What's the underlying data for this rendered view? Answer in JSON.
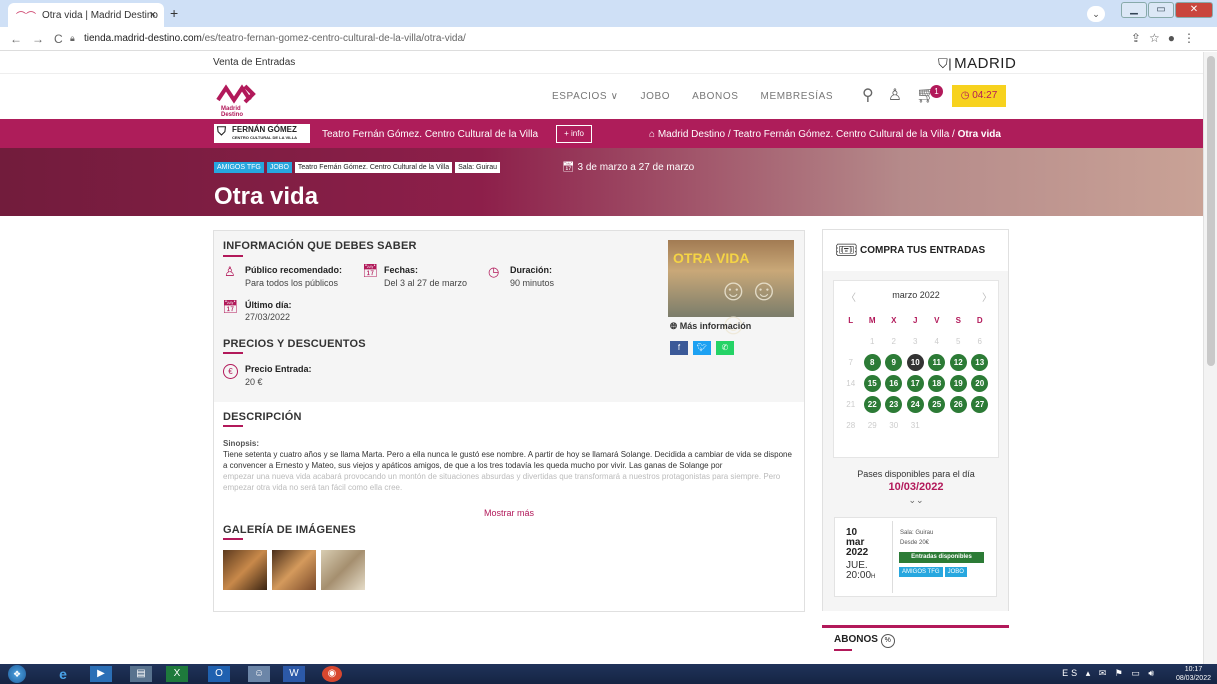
{
  "browser": {
    "tab_title": "Otra vida | Madrid Destino",
    "tab_close": "×",
    "new_tab": "+",
    "url_host": "tienda.madrid-destino.com",
    "url_path": "/es/teatro-fernan-gomez-centro-cultural-de-la-villa/otra-vida/"
  },
  "site": {
    "top_label": "Venta de Entradas",
    "madrid_label": "MADRID",
    "logo_text": "Madrid Destino",
    "nav": [
      "ESPACIOS ∨",
      "JOBO",
      "ABONOS",
      "MEMBRESÍAS"
    ],
    "cart_count": "1",
    "timer": "◷ 04:27"
  },
  "venue_bar": {
    "logo_title": "FERNÁN GÓMEZ",
    "logo_sub": "CENTRO CULTURAL DE LA VILLA",
    "venue_name": "Teatro Fernán Gómez. Centro Cultural de la Villa",
    "info_button": "+ info",
    "breadcrumb_prefix": "⌂ Madrid Destino / Teatro Fernán Gómez. Centro Cultural de la Villa / ",
    "breadcrumb_current": "Otra vida"
  },
  "hero": {
    "tags": [
      {
        "text": "AMIGOS TFG",
        "style": "blue"
      },
      {
        "text": "JOBO",
        "style": "blue"
      },
      {
        "text": "Teatro Fernán Gómez. Centro Cultural de la Villa",
        "style": "white"
      },
      {
        "text": "Sala: Guirau",
        "style": "white"
      }
    ],
    "dates": "3 de marzo a 27 de marzo",
    "title": "Otra vida"
  },
  "info": {
    "section_title": "INFORMACIÓN QUE DEBES SABER",
    "publico_label": "Público recomendado:",
    "publico_value": "Para todos los públicos",
    "fechas_label": "Fechas:",
    "fechas_value": "Del 3 al 27 de marzo",
    "duracion_label": "Duración:",
    "duracion_value": "90 minutos",
    "ultimo_label": "Último día:",
    "ultimo_value": "27/03/2022",
    "precios_title": "PRECIOS Y DESCUENTOS",
    "precio_label": "Precio Entrada:",
    "precio_value": "20 €",
    "poster_title": "OTRA VIDA",
    "mas_info": "Más información"
  },
  "descripcion": {
    "title": "DESCRIPCIÓN",
    "sinopsis_label": "Sinopsis:",
    "text": "Tiene setenta y cuatro años y se llama Marta. Pero a ella nunca le gustó ese nombre. A partir de hoy se llamará Solange. Decidida a cambiar de vida se dispone a convencer a Ernesto y Mateo, sus viejos y apáticos amigos, de que a los tres todavía les queda mucho por vivir. Las ganas de Solange por",
    "text_fade": "empezar una nueva vida acabará provocando un montón de situaciones absurdas y divertidas que transformará a nuestros protagonistas para siempre. Pero empezar otra vida no será tan fácil como ella cree.",
    "mostrar": "Mostrar más"
  },
  "galeria": {
    "title": "GALERÍA DE IMÁGENES"
  },
  "compra": {
    "title": "COMPRA TUS ENTRADAS",
    "month": "marzo 2022",
    "day_headers": [
      "L",
      "M",
      "X",
      "J",
      "V",
      "S",
      "D"
    ],
    "days": [
      {
        "d": "",
        "s": ""
      },
      {
        "d": "1",
        "s": "off"
      },
      {
        "d": "2",
        "s": "off"
      },
      {
        "d": "3",
        "s": "off"
      },
      {
        "d": "4",
        "s": "off"
      },
      {
        "d": "5",
        "s": "off"
      },
      {
        "d": "6",
        "s": "off"
      },
      {
        "d": "7",
        "s": "off"
      },
      {
        "d": "8",
        "s": "av"
      },
      {
        "d": "9",
        "s": "av"
      },
      {
        "d": "10",
        "s": "sel"
      },
      {
        "d": "11",
        "s": "av"
      },
      {
        "d": "12",
        "s": "av"
      },
      {
        "d": "13",
        "s": "av"
      },
      {
        "d": "14",
        "s": "off"
      },
      {
        "d": "15",
        "s": "av"
      },
      {
        "d": "16",
        "s": "av"
      },
      {
        "d": "17",
        "s": "av"
      },
      {
        "d": "18",
        "s": "av"
      },
      {
        "d": "19",
        "s": "av"
      },
      {
        "d": "20",
        "s": "av"
      },
      {
        "d": "21",
        "s": "off"
      },
      {
        "d": "22",
        "s": "av"
      },
      {
        "d": "23",
        "s": "av"
      },
      {
        "d": "24",
        "s": "av"
      },
      {
        "d": "25",
        "s": "av"
      },
      {
        "d": "26",
        "s": "av"
      },
      {
        "d": "27",
        "s": "av"
      },
      {
        "d": "28",
        "s": "off"
      },
      {
        "d": "29",
        "s": "off"
      },
      {
        "d": "30",
        "s": "off"
      },
      {
        "d": "31",
        "s": "off"
      }
    ],
    "pases_label": "Pases disponibles para el día",
    "pases_date": "10/03/2022",
    "event": {
      "day": "10",
      "month": "mar",
      "year": "2022",
      "dow": "JUE.",
      "time": "20:00",
      "time_suffix": "H",
      "sala": "Sala: Guirau",
      "desde": "Desde 20€",
      "disponibles": "Entradas disponibles",
      "tags": [
        "AMIGOS TFG",
        "JOBO"
      ]
    }
  },
  "abonos": {
    "title": "ABONOS"
  },
  "taskbar": {
    "lang": "ES",
    "time": "10:17",
    "date": "08/03/2022"
  },
  "colors": {
    "brand": "#ae1d5a",
    "available": "#2c7b36",
    "tag_blue": "#27a7df",
    "timer_bg": "#f7d21e"
  }
}
